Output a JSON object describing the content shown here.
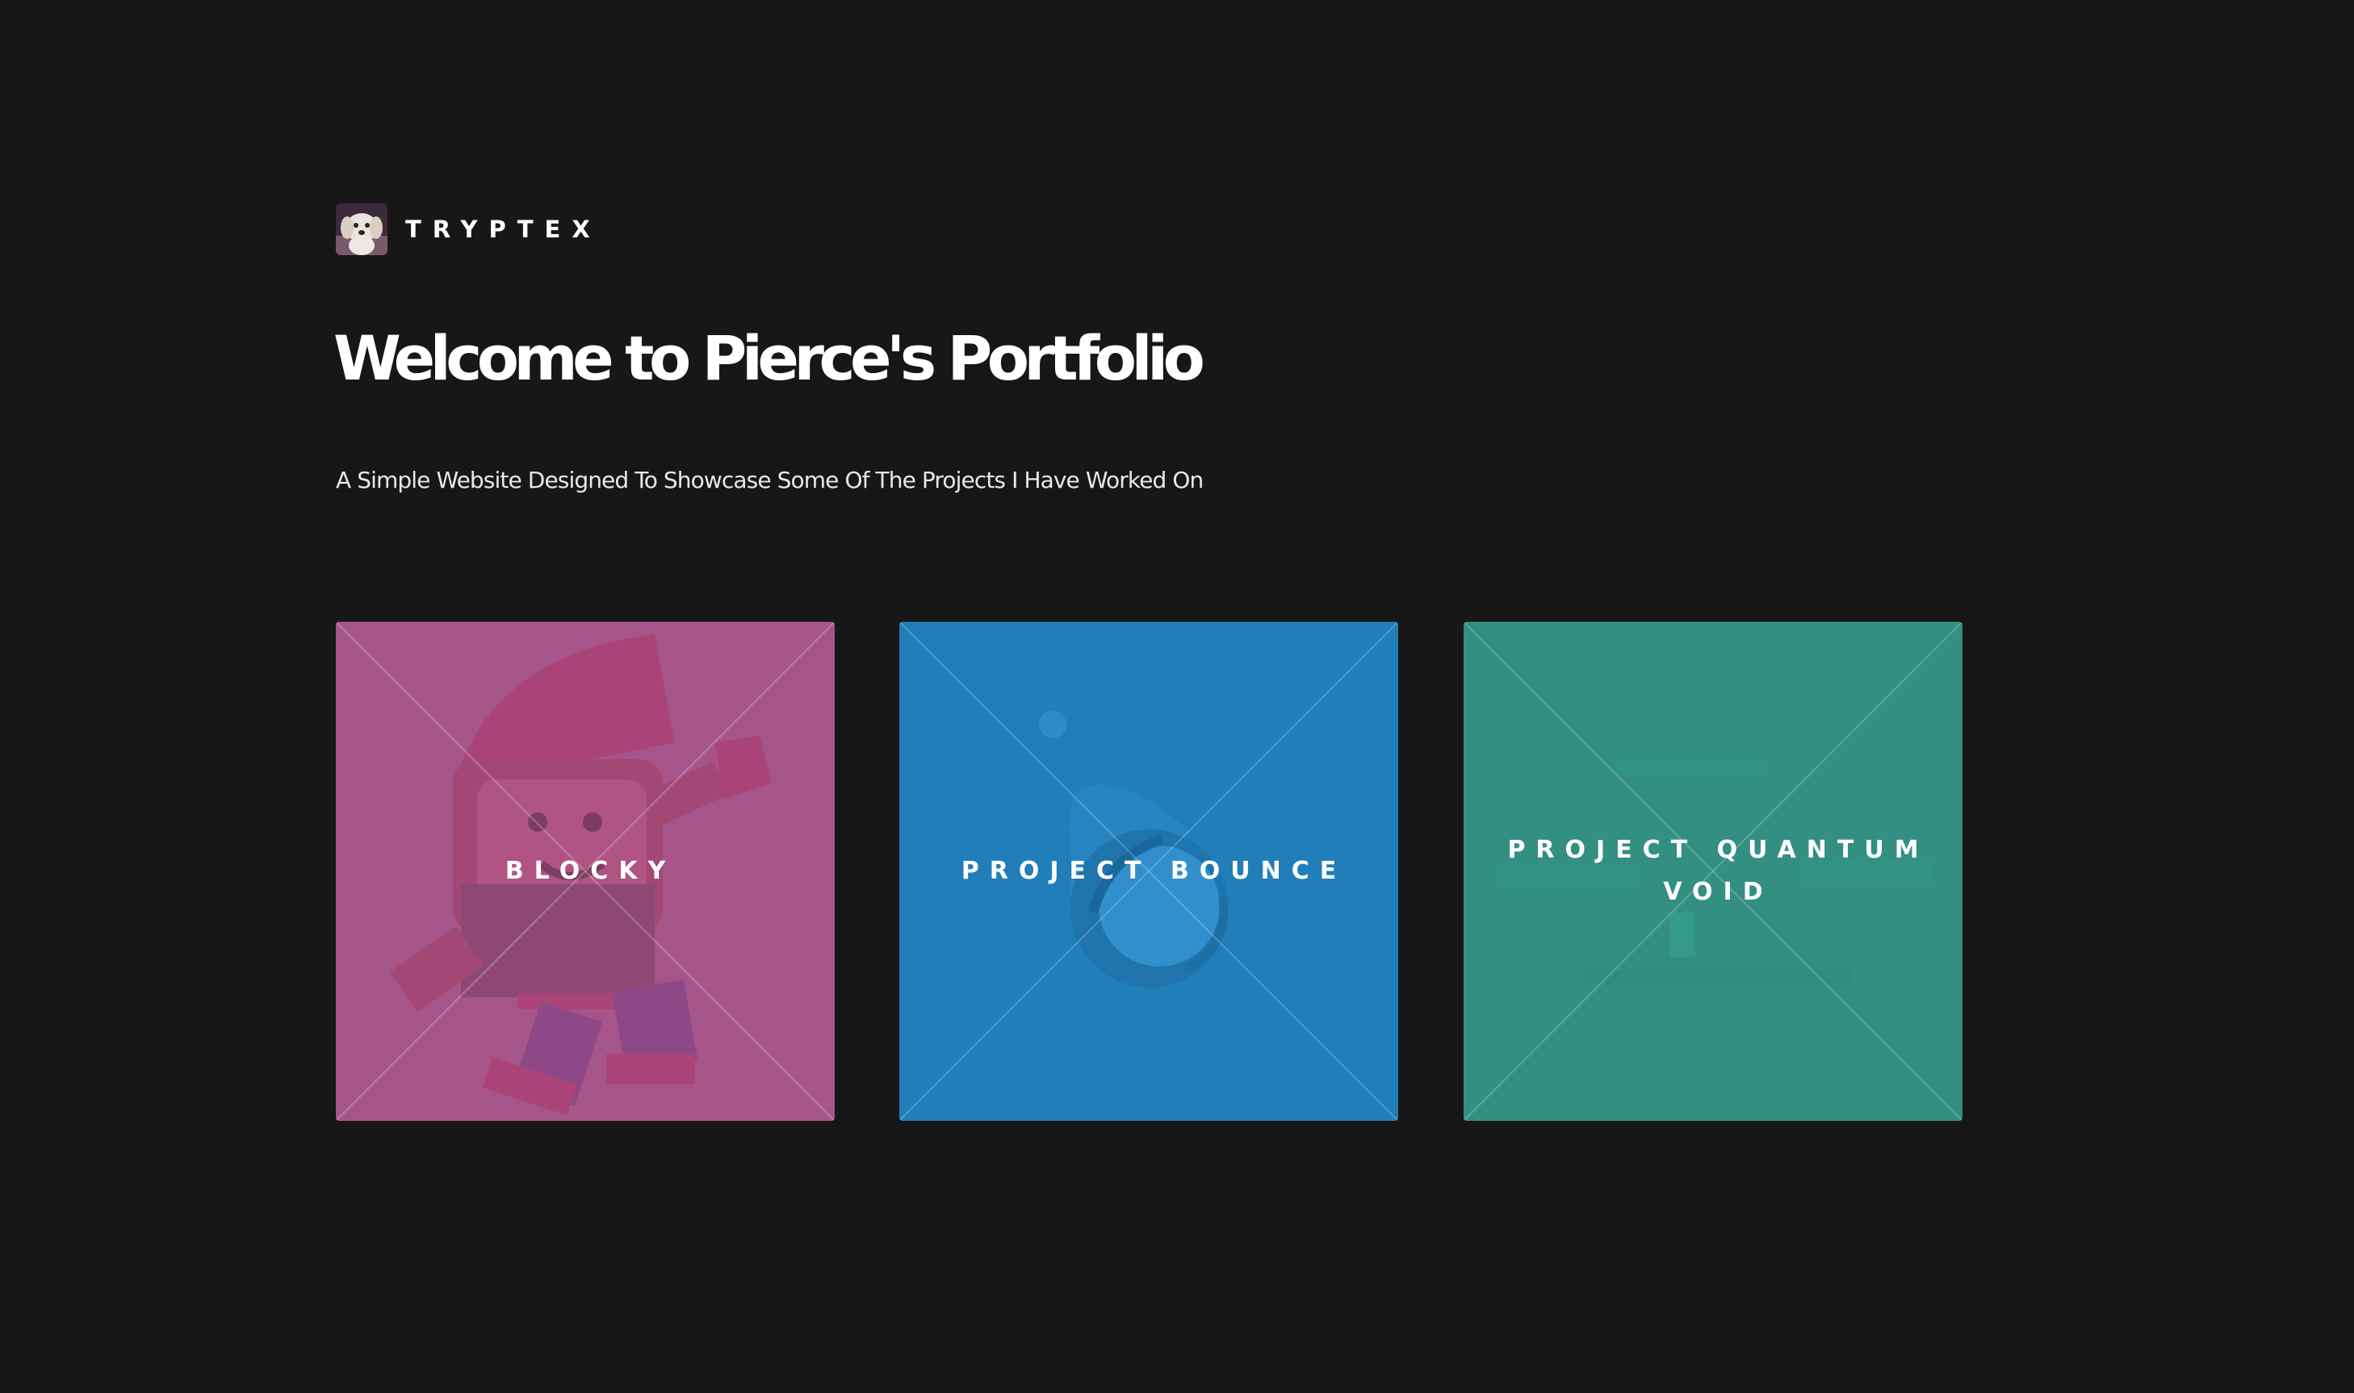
{
  "header": {
    "logo_text": "TRYPTEX",
    "avatar_icon": "dog-avatar-icon"
  },
  "hero": {
    "title": "Welcome to Pierce's Portfolio",
    "subtitle": "A Simple Website Designed To Showcase Some Of The Projects I Have Worked On"
  },
  "projects": [
    {
      "label": "BLOCKY",
      "color": "#a5558a",
      "icon": "blocky-character-icon"
    },
    {
      "label": "PROJECT BOUNCE",
      "color": "#217eb8",
      "icon": "bounce-ball-icon"
    },
    {
      "label": "PROJECT QUANTUM VOID",
      "color": "#338f81",
      "icon": "quantum-void-scene-icon"
    }
  ],
  "colors": {
    "background": "#171717",
    "text": "#ffffff"
  }
}
